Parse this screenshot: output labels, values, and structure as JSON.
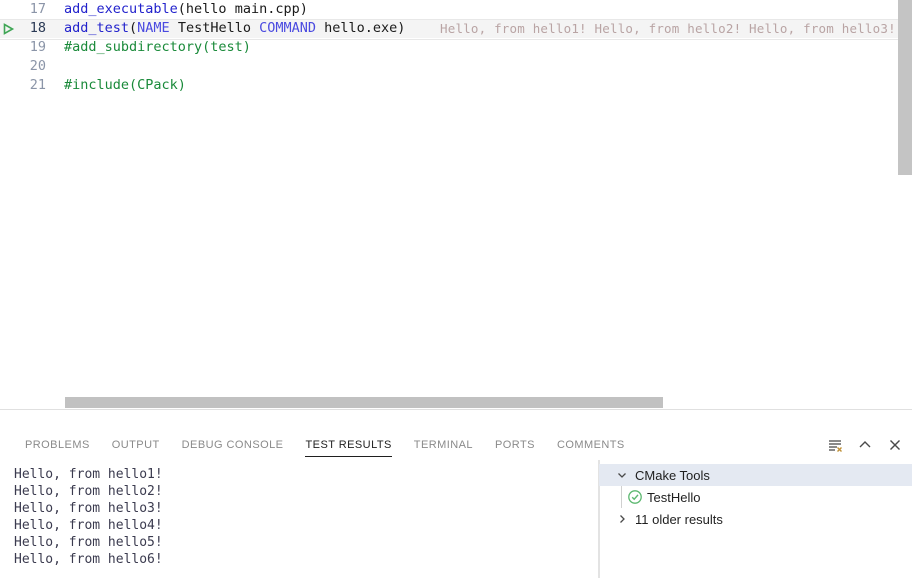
{
  "editor": {
    "lines": [
      {
        "number": "17",
        "active": false,
        "has_run_icon": false,
        "tokens": [
          {
            "text": "add_executable",
            "kind": "fn"
          },
          {
            "text": "(hello main.cpp)",
            "kind": "txt"
          }
        ],
        "inline_hint": ""
      },
      {
        "number": "18",
        "active": true,
        "has_run_icon": true,
        "run_icon": "run-test-icon",
        "tokens": [
          {
            "text": "add_test",
            "kind": "fn"
          },
          {
            "text": "(",
            "kind": "txt"
          },
          {
            "text": "NAME",
            "kind": "kw"
          },
          {
            "text": " TestHello ",
            "kind": "txt"
          },
          {
            "text": "COMMAND",
            "kind": "kw"
          },
          {
            "text": " hello.exe)",
            "kind": "txt"
          }
        ],
        "inline_hint": "Hello, from hello1! Hello, from hello2! Hello, from hello3!"
      },
      {
        "number": "19",
        "active": false,
        "has_run_icon": false,
        "tokens": [
          {
            "text": "#add_subdirectory(test)",
            "kind": "cmt"
          }
        ],
        "inline_hint": ""
      },
      {
        "number": "20",
        "active": false,
        "has_run_icon": false,
        "tokens": [],
        "inline_hint": ""
      },
      {
        "number": "21",
        "active": false,
        "has_run_icon": false,
        "tokens": [
          {
            "text": "#include(CPack)",
            "kind": "cmt"
          }
        ],
        "inline_hint": ""
      }
    ],
    "vertical_scrollbar": {
      "name": "editor-vertical-scrollbar"
    },
    "horizontal_scrollbar": {
      "name": "editor-horizontal-scrollbar"
    }
  },
  "panel": {
    "tabs": [
      {
        "label": "PROBLEMS",
        "active": false,
        "name": "tab-problems"
      },
      {
        "label": "OUTPUT",
        "active": false,
        "name": "tab-output"
      },
      {
        "label": "DEBUG CONSOLE",
        "active": false,
        "name": "tab-debug-console"
      },
      {
        "label": "TEST RESULTS",
        "active": true,
        "name": "tab-test-results"
      },
      {
        "label": "TERMINAL",
        "active": false,
        "name": "tab-terminal"
      },
      {
        "label": "PORTS",
        "active": false,
        "name": "tab-ports"
      },
      {
        "label": "COMMENTS",
        "active": false,
        "name": "tab-comments"
      }
    ],
    "actions": [
      {
        "name": "clear-output-icon"
      },
      {
        "name": "chevron-up-icon"
      },
      {
        "name": "close-icon"
      }
    ],
    "output_lines": [
      "Hello, from hello1!",
      "Hello, from hello2!",
      "Hello, from hello3!",
      "Hello, from hello4!",
      "Hello, from hello5!",
      "Hello, from hello6!"
    ],
    "tree": [
      {
        "label": "CMake Tools",
        "twisty": "chevron-down-icon",
        "selected": true,
        "indent": 0,
        "status": null
      },
      {
        "label": "TestHello",
        "twisty": null,
        "selected": false,
        "indent": 1,
        "status": "passed-check-icon"
      },
      {
        "label": "11 older results",
        "twisty": "chevron-right-icon",
        "selected": false,
        "indent": 0,
        "status": null
      }
    ]
  },
  "colors": {
    "function": "#2222cc",
    "keyword": "#4a4ae0",
    "comment": "#1a8a3a",
    "inline_hint": "#b9a4a4",
    "pass_green": "#3fa655",
    "selection": "#e4e9f2"
  }
}
